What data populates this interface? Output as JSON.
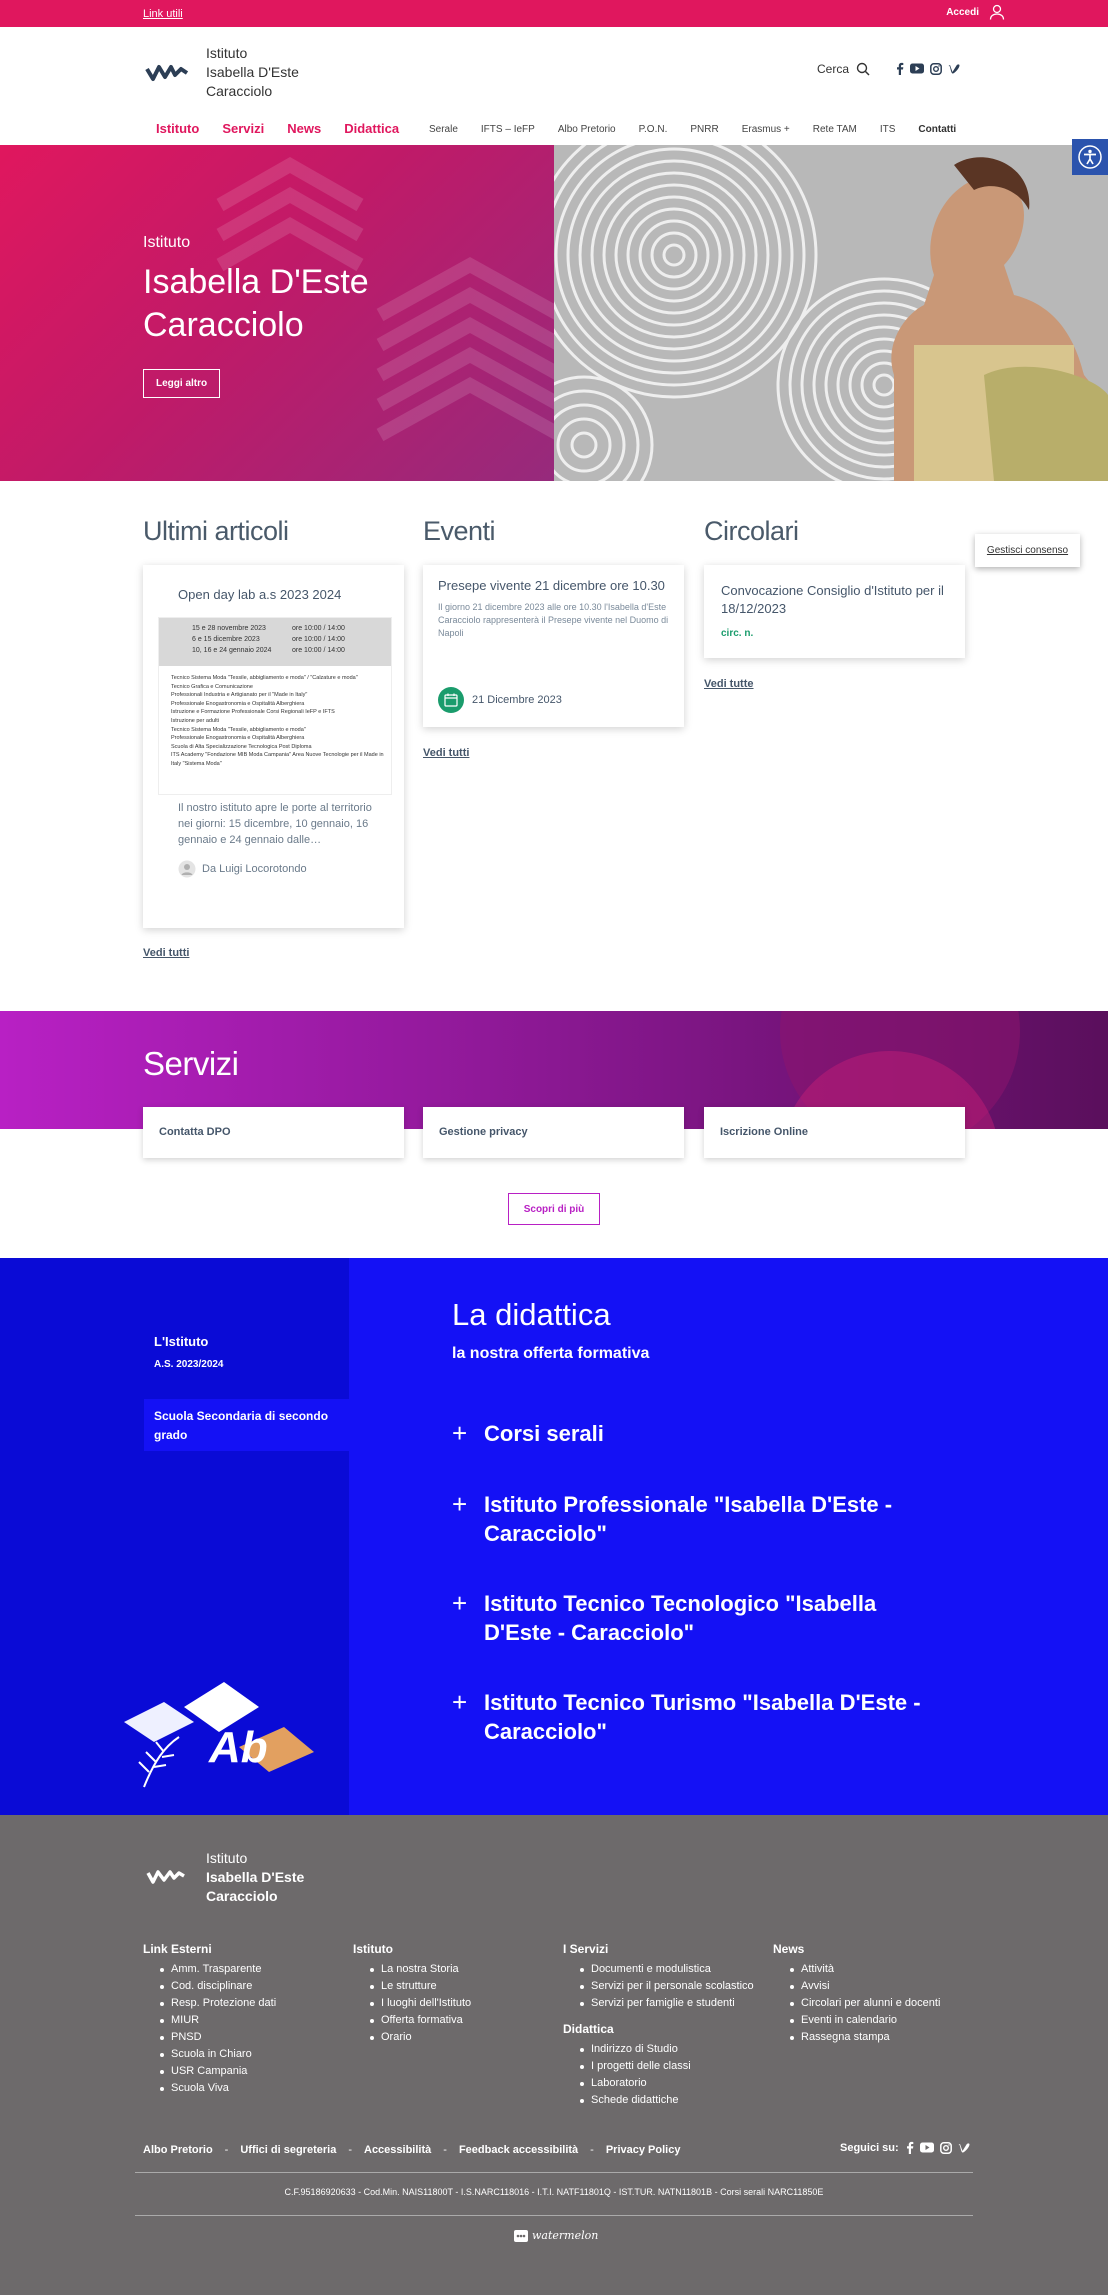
{
  "topbar": {
    "links": "Link utili",
    "login": "Accedi"
  },
  "header": {
    "brand_line1": "Istituto",
    "brand_line2": "Isabella D'Este",
    "brand_line3": "Caracciolo",
    "search": "Cerca",
    "main_nav": [
      "Istituto",
      "Servizi",
      "News",
      "Didattica"
    ],
    "sub_nav": [
      "Serale",
      "IFTS – IeFP",
      "Albo Pretorio",
      "P.O.N.",
      "PNRR",
      "Erasmus +",
      "Rete TAM",
      "ITS",
      "Contatti"
    ]
  },
  "hero": {
    "kicker": "Istituto",
    "title": "Isabella D'Este Caracciolo",
    "button": "Leggi altro"
  },
  "articles": {
    "title": "Ultimi articoli",
    "card_title": "Open day lab a.s 2023 2024",
    "poster_rows": [
      [
        "15 e 28 novembre 2023",
        "ore 10:00 / 14:00"
      ],
      [
        "6 e 15 dicembre 2023",
        "ore 10:00 / 14:00"
      ],
      [
        "10, 16 e 24 gennaio 2024",
        "ore 10:00 / 14:00"
      ]
    ],
    "poster_text": [
      "Tecnico Sistema Moda \"Tessile, abbigliamento e moda\" / \"Calzature e moda\"",
      "Tecnico Grafica e Comunicazione",
      "Professionali Industria e Artigianato per il \"Made in Italy\"",
      "Professionale Enogastronomia e Ospitalità Alberghiera",
      "Istruzione e Formazione Professionale Corsi Regionali IeFP e IFTS",
      "Istruzione per adulti",
      "Tecnico Sistema Moda \"Tessile, abbigliamento e moda\"",
      "Professionale Enogastronomia e Ospitalità Alberghiera",
      "Scuola di Alta Specializzazione Tecnologica Post Diploma",
      "ITS Academy \"Fondazione MIB Moda Campania\" Area Nuove Tecnologie per il Made in Italy \"Sistema Moda\""
    ],
    "excerpt": "Il nostro istituto apre le porte al territorio nei giorni: 15 dicembre, 10 gennaio, 16 gennaio e 24 gennaio dalle…",
    "author": "Da Luigi Locorotondo",
    "see_all": "Vedi tutti"
  },
  "events": {
    "title": "Eventi",
    "card_title": "Presepe vivente 21 dicembre ore 10.30",
    "excerpt": "Il giorno 21 dicembre 2023 alle ore 10.30 l'Isabella d'Este Caracciolo rappresenterà il Presepe vivente nel Duomo di Napoli",
    "date": "21 Dicembre 2023",
    "see_all": "Vedi tutti"
  },
  "circolari": {
    "title": "Circolari",
    "card_title": "Convocazione Consiglio d'Istituto per il 18/12/2023",
    "tag": "circ. n.",
    "see_all": "Vedi tutte"
  },
  "consent": "Gestisci consenso",
  "servizi": {
    "title": "Servizi",
    "cards": [
      "Contatta DPO",
      "Gestione privacy",
      "Iscrizione Online"
    ],
    "button": "Scopri di più"
  },
  "didattica": {
    "tab1": "L'Istituto",
    "tab1_year": "A.S. 2023/2024",
    "tab2": "Scuola Secondaria di secondo grado",
    "title": "La didattica",
    "subtitle": "la nostra offerta formativa",
    "items": [
      "Corsi serali",
      "Istituto Professionale \"Isabella D'Este - Caracciolo\"",
      "Istituto Tecnico Tecnologico \"Isabella D'Este - Caracciolo\"",
      "Istituto Tecnico Turismo \"Isabella D'Este -Caracciolo\""
    ],
    "illustration_text": "Ab"
  },
  "footer": {
    "brand_line1": "Istituto",
    "brand_line2": "Isabella D'Este",
    "brand_line3": "Caracciolo",
    "cols": [
      {
        "title": "Link Esterni",
        "items": [
          "Amm. Trasparente",
          "Cod. disciplinare",
          "Resp. Protezione dati",
          "MIUR",
          "PNSD",
          "Scuola in Chiaro",
          "USR Campania",
          "Scuola Viva"
        ]
      },
      {
        "title": "Istituto",
        "items": [
          "La nostra Storia",
          "Le strutture",
          "I luoghi dell'Istituto",
          "Offerta formativa",
          "Orario"
        ]
      },
      {
        "title": "I Servizi",
        "items": [
          "Documenti e modulistica",
          "Servizi per il personale scolastico",
          "Servizi per famiglie e studenti"
        ]
      },
      {
        "title": "Didattica",
        "items": [
          "Indirizzo di Studio",
          "I progetti delle classi",
          "Laboratorio",
          "Schede didattiche"
        ]
      },
      {
        "title": "News",
        "items": [
          "Attività",
          "Avvisi",
          "Circolari per alunni e docenti",
          "Eventi in calendario",
          "Rassegna stampa"
        ]
      }
    ],
    "links": [
      "Albo Pretorio",
      "Uffici di segreteria",
      "Accessibilità",
      "Feedback accessibilità",
      "Privacy Policy"
    ],
    "follow": "Seguici su:",
    "cf": "C.F.95186920633 - Cod.Min. NAIS11800T - I.S.NARC118016 - I.T.I. NATF11801Q - IST.TUR. NATN11801B - Corsi serali NARC11850E",
    "watermark": "watermelon"
  },
  "colors": {
    "brand": "#e0175e",
    "servizi": "#b820c4",
    "didattica": "#1411f5",
    "footer": "#6d6a6b",
    "text": "#45566a",
    "event_green": "#1a9c6c"
  }
}
